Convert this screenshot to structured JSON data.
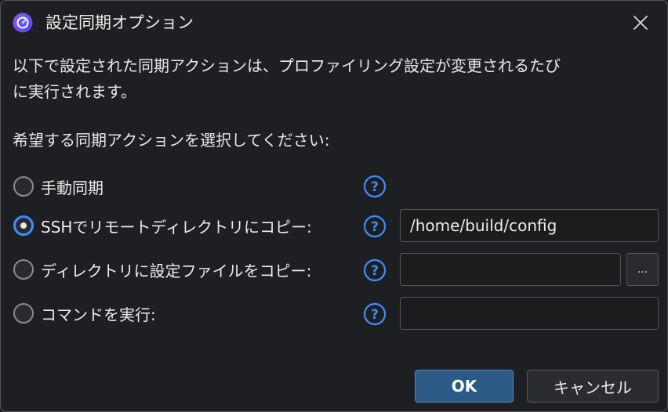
{
  "window": {
    "title": "設定同期オプション",
    "close_icon": "close-icon",
    "app_icon": "app-logo-icon"
  },
  "description": {
    "line1": "以下で設定された同期アクションは、プロファイリング設定が変更されるたび",
    "line2": "に実行されます。"
  },
  "prompt": "希望する同期アクションを選択してください:",
  "options": [
    {
      "label": "手動同期",
      "selected": false
    },
    {
      "label": "SSHでリモートディレクトリにコピー:",
      "selected": true,
      "field_value": "/home/build/config"
    },
    {
      "label": "ディレクトリに設定ファイルをコピー:",
      "selected": false,
      "field_value": "",
      "browse_label": "..."
    },
    {
      "label": "コマンドを実行:",
      "selected": false,
      "field_value": ""
    }
  ],
  "help_icon": "question-circle-icon",
  "buttons": {
    "ok": "OK",
    "cancel": "キャンセル"
  },
  "colors": {
    "accent": "#3d8eff",
    "ok_button": "#2c5a87",
    "background": "#1e1f22"
  }
}
